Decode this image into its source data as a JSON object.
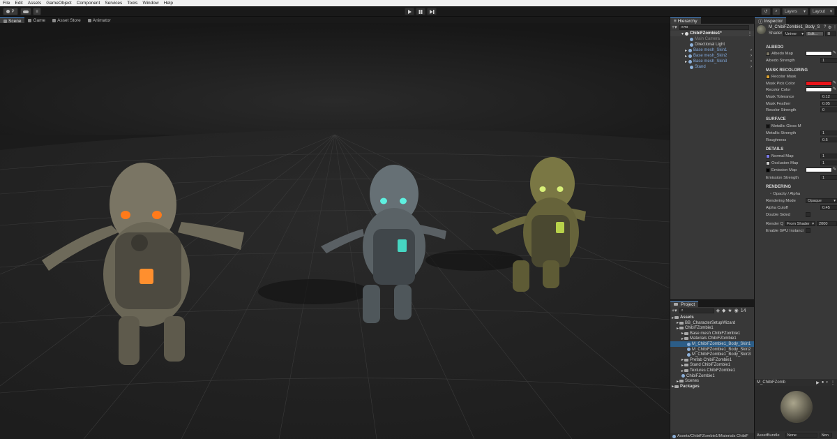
{
  "menu": [
    "File",
    "Edit",
    "Assets",
    "GameObject",
    "Component",
    "Services",
    "Tools",
    "Window",
    "Help"
  ],
  "toolbar": {
    "account": "P",
    "layers": "Layers",
    "layout": "Layout"
  },
  "scene_tabs": [
    "Scene",
    "Game",
    "Asset Store",
    "Animator"
  ],
  "hierarchy": {
    "title": "Hierarchy",
    "search": "All",
    "root": "ChibiFZombie1*",
    "items": [
      {
        "label": "Main Camera",
        "style": "grey"
      },
      {
        "label": "Directional Light",
        "style": "normal"
      },
      {
        "label": "Base mesh_Skin1",
        "style": "blue"
      },
      {
        "label": "Base mesh_Skin2",
        "style": "blue"
      },
      {
        "label": "Base mesh_Skin3",
        "style": "blue"
      },
      {
        "label": "Stand",
        "style": "blue"
      }
    ]
  },
  "project": {
    "title": "Project",
    "count": "14",
    "tree": [
      {
        "label": "Assets",
        "bold": true
      },
      {
        "label": "BB_CharacterSetupWizard"
      },
      {
        "label": "ChibiFZombie1"
      },
      {
        "label": "Base mesh ChibiFZombie1"
      },
      {
        "label": "Materials ChibiFZombie1"
      },
      {
        "label": "M_ChibiFZombie1_Body_Skin1",
        "selected": true
      },
      {
        "label": "M_ChibiFZombie1_Body_Skin2"
      },
      {
        "label": "M_ChibiFZombie1_Body_Skin3"
      },
      {
        "label": "Prefab ChibiFZombie1"
      },
      {
        "label": "Stand ChibiFZombie1"
      },
      {
        "label": "Textures ChibiFZombie1"
      },
      {
        "label": "ChibiFZombie1"
      },
      {
        "label": "Scenes"
      },
      {
        "label": "Packages",
        "bold": true
      }
    ],
    "path": "Assets/ChibiFZombie1/Materials ChibiF"
  },
  "inspector": {
    "title": "Inspector",
    "material": "M_ChibiFZombie1_Body_S",
    "shader_label": "Shader",
    "shader_value": "Univer",
    "edit_label": "Edit...",
    "sections": {
      "albedo": "ALBEDO",
      "mask": "MASK RECOLORING",
      "surface": "SURFACE",
      "details": "DETAILS",
      "rendering": "RENDERING"
    },
    "albedo_map": "Albedo Map",
    "albedo_strength": "Albedo Strength",
    "albedo_strength_val": "1",
    "recolor_mask": "Recolor Mask",
    "mask_pick": "Mask Pick Color",
    "recolor_color": "Recolor Color",
    "mask_tol": "Mask Tolerance",
    "mask_tol_val": "0.12",
    "mask_feather": "Mask Feather",
    "mask_feather_val": "0.05",
    "recolor_strength": "Recolor Strength",
    "recolor_strength_val": "0",
    "metallic_gloss": "Metallic Gloss M",
    "metallic_strength": "Metallic Strength",
    "metallic_strength_val": "1",
    "roughness": "Roughness",
    "roughness_val": "0.5",
    "normal_map": "Normal Map",
    "normal_map_val": "1",
    "occlusion_map": "Occlusion Map",
    "occlusion_map_val": "1",
    "emission_map": "Emission Map",
    "emission_strength": "Emission Strength",
    "emission_strength_val": "1",
    "opacity_alpha": "Opacity / Alpha",
    "rendering_mode": "Rendering Mode",
    "rendering_mode_val": "Opaque",
    "alpha_cutoff": "Alpha Cutoff",
    "alpha_cutoff_val": "0.45",
    "double_sided": "Double Sided",
    "render_queue": "Render Q",
    "render_queue_src": "From Shader",
    "render_queue_val": "2000",
    "gpu_instancing": "Enable GPU Instanci",
    "preview_name": "M_ChibiFZomb",
    "asset_bundle": "AssetBundle",
    "asset_bundle_val": "None",
    "asset_bundle_val2": "Non",
    "colors": {
      "mask_pick": "#e8141a",
      "recolor": "#ffffff",
      "albedo": "#ffffff",
      "emission": "#ffffff",
      "selection": "#2c5d87"
    }
  }
}
